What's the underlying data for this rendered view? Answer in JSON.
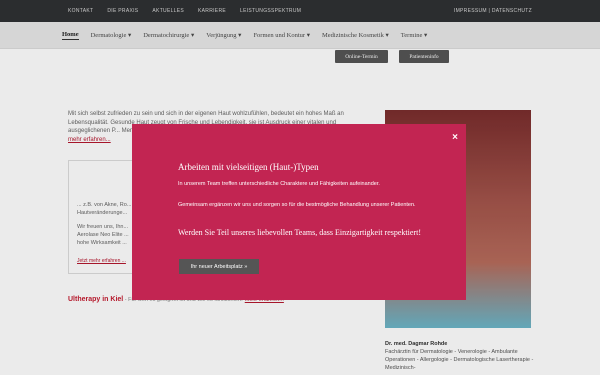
{
  "topbar": {
    "links": [
      "KONTAKT",
      "DIE PRAXIS",
      "AKTUELLES",
      "KARRIERE",
      "LEISTUNGSSPEKTRUM"
    ],
    "right": "IMPRESSUM | DATENSCHUTZ"
  },
  "nav": {
    "items": [
      "Home",
      "Dermatologie ▾",
      "Dermatochirurgie ▾",
      "Verjüngung ▾",
      "Formen und Kontur ▾",
      "Medizinische Kosmetik ▾",
      "Termine ▾"
    ]
  },
  "buttons": {
    "online_termin": "Online-Termin",
    "patienteninfo": "Patienteninfo"
  },
  "content": {
    "intro": "Mit sich selbst zufrieden zu sein und sich in der eigenen Haut wohlzufühlen, bedeutet ein hohes Maß an Lebensqualität. Gesunde Haut zeugt von Frische und Lebendigkeit, sie ist Ausdruck einer vitalen und ausgeglichenen P... Menschen - beruflich...",
    "more": "mehr erfahren...",
    "box_line1": "... z.B. von Akne, Ro...",
    "box_line2": "Hautveränderunge...",
    "box_line3": "Wir freuen uns, Ihn...",
    "box_line4": "Aerolase Neo Elite ...",
    "box_line5": "hohe Wirksamkeit ...",
    "box_more": "Jetzt mehr erfahren ...",
    "ultherapy_title": "Ultherapy in Kiel",
    "ultherapy_rest": " - Für wen es geeignet ist und wie es funktioniert.",
    "ultherapy_more": "mehr erfahren..."
  },
  "doctor": {
    "name": "Dr. med. Dagmar Rohde",
    "title": "Fachärztin für Dermatologie - Venerologie - Ambulante Operationen - Allergologie - Dermatologische Lasertherapie - Medizinisch-"
  },
  "modal": {
    "close": "×",
    "heading": "Arbeiten mit vielseitigen (Haut-)Typen",
    "p1": "In unserem Team treffen unterschiedliche Charaktere und Fähigkeiten aufeinander.",
    "p2": "Gemeinsam ergänzen wir uns und sorgen so für die bestmögliche Behandlung unserer Patienten.",
    "subheading": "Werden Sie Teil unseres liebevollen Teams, dass Einzigartigkeit respektiert!",
    "cta": "Ihr neuer Arbeitsplatz »"
  },
  "colors": {
    "modal_bg": "#c22552",
    "accent": "#c51c30",
    "topbar": "#2f3133",
    "button_dark": "#555555"
  }
}
